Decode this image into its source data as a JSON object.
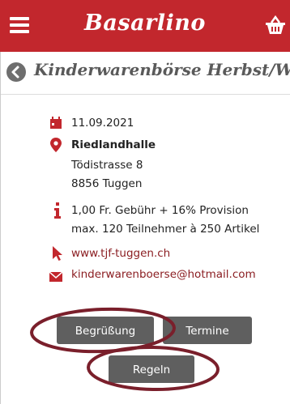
{
  "header": {
    "logo": "Basarlino",
    "menu_icon": "hamburger-menu-icon",
    "basket_icon": "basket-icon",
    "brand_color": "#c2272d"
  },
  "page": {
    "title": "Kinderwarenbörse Herbst/Winter",
    "back_icon": "back-arrow-icon"
  },
  "event": {
    "date": "11.09.2021",
    "venue_name": "Riedlandhalle",
    "street": "Tödistrasse 8",
    "city": "8856 Tuggen",
    "fee": "1,00 Fr. Gebühr + 16% Provision",
    "limits": "max. 120 Teilnehmer à 250 Artikel",
    "website": "www.tjf-tuggen.ch",
    "email": "kinderwarenboerse@hotmail.com"
  },
  "buttons": {
    "greeting": "Begrüßung",
    "dates": "Termine",
    "rules": "Regeln"
  },
  "colors": {
    "icon_red": "#c2272d",
    "button_gray": "#5f5f5f",
    "highlight_ring": "#7a1f2b"
  }
}
